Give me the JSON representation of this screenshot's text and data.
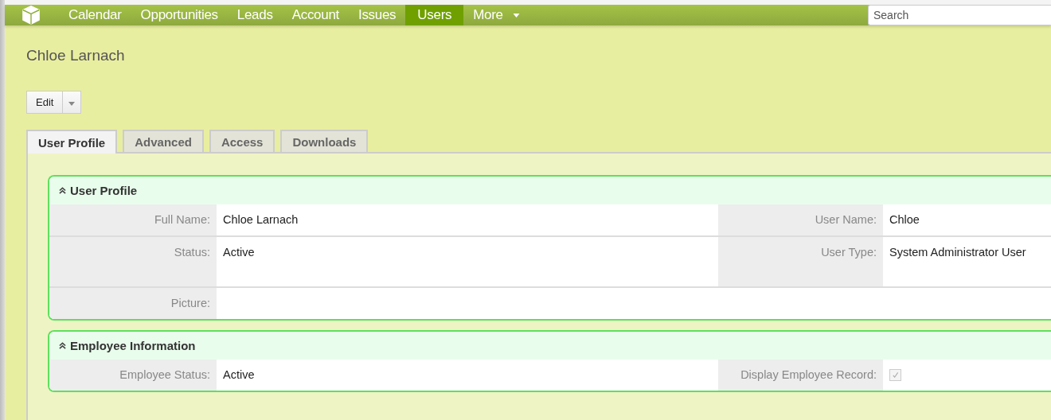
{
  "nav": {
    "items": [
      {
        "label": "Calendar",
        "selected": false,
        "dropdown": false
      },
      {
        "label": "Opportunities",
        "selected": false,
        "dropdown": false
      },
      {
        "label": "Leads",
        "selected": false,
        "dropdown": false
      },
      {
        "label": "Account",
        "selected": false,
        "dropdown": false
      },
      {
        "label": "Issues",
        "selected": false,
        "dropdown": false
      },
      {
        "label": "Users",
        "selected": true,
        "dropdown": false
      },
      {
        "label": "More",
        "selected": false,
        "dropdown": true
      }
    ],
    "search": {
      "placeholder": "Search"
    }
  },
  "record_title": "Chloe Larnach",
  "actions": {
    "button": "Edit"
  },
  "tabs": [
    {
      "label": "User Profile",
      "selected": true
    },
    {
      "label": "Advanced",
      "selected": false
    },
    {
      "label": "Access",
      "selected": false
    },
    {
      "label": "Downloads",
      "selected": false
    }
  ],
  "sections": [
    {
      "title": "User Profile",
      "rows": [
        {
          "tall": false,
          "fields": [
            {
              "kind": "text",
              "label": "Full Name:",
              "value": "Chloe Larnach"
            },
            {
              "kind": "text",
              "label": "User Name:",
              "value": "Chloe"
            }
          ]
        },
        {
          "tall": true,
          "fields": [
            {
              "kind": "text",
              "label": "Status:",
              "value": "Active"
            },
            {
              "kind": "text",
              "label": "User Type:",
              "value": "System Administrator User"
            }
          ]
        },
        {
          "tall": false,
          "fields": [
            {
              "kind": "empty",
              "label": "Picture:"
            }
          ]
        }
      ]
    },
    {
      "title": "Employee Information",
      "rows": [
        {
          "tall": false,
          "fields": [
            {
              "kind": "text",
              "label": "Employee Status:",
              "value": "Active"
            },
            {
              "kind": "checkbox",
              "label": "Display Employee Record:",
              "checked": true
            }
          ]
        }
      ]
    }
  ]
}
